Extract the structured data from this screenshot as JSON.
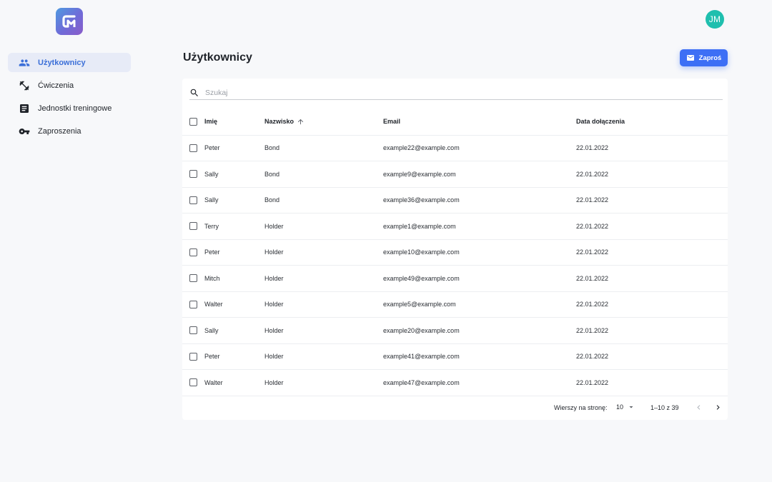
{
  "header": {
    "logo_icon": "app-logo-icon",
    "avatar_initials": "JM",
    "avatar_color": "#1fbfae"
  },
  "sidebar": {
    "items": [
      {
        "label": "Użytkownicy",
        "icon": "users-icon",
        "active": true
      },
      {
        "label": "Ćwiczenia",
        "icon": "fitness-icon",
        "active": false
      },
      {
        "label": "Jednostki treningowe",
        "icon": "list-icon",
        "active": false
      },
      {
        "label": "Zaproszenia",
        "icon": "key-icon",
        "active": false
      }
    ]
  },
  "main": {
    "title": "Użytkownicy",
    "invite_button": "Zaproś",
    "accent_color": "#3d6ff5",
    "search": {
      "placeholder": "Szukaj",
      "value": ""
    },
    "table": {
      "columns": [
        "Imię",
        "Nazwisko",
        "Email",
        "Data dołączenia"
      ],
      "sorted_column": "Nazwisko",
      "sort_direction": "ascending",
      "rows": [
        [
          "Peter",
          "Bond",
          "example22@example.com",
          "22.01.2022"
        ],
        [
          "Sally",
          "Bond",
          "example9@example.com",
          "22.01.2022"
        ],
        [
          "Sally",
          "Bond",
          "example36@example.com",
          "22.01.2022"
        ],
        [
          "Terry",
          "Holder",
          "example1@example.com",
          "22.01.2022"
        ],
        [
          "Peter",
          "Holder",
          "example10@example.com",
          "22.01.2022"
        ],
        [
          "Mitch",
          "Holder",
          "example49@example.com",
          "22.01.2022"
        ],
        [
          "Walter",
          "Holder",
          "example5@example.com",
          "22.01.2022"
        ],
        [
          "Sally",
          "Holder",
          "example20@example.com",
          "22.01.2022"
        ],
        [
          "Peter",
          "Holder",
          "example41@example.com",
          "22.01.2022"
        ],
        [
          "Walter",
          "Holder",
          "example47@example.com",
          "22.01.2022"
        ]
      ]
    },
    "pagination": {
      "rows_per_page_label": "Wierszy na stronę:",
      "rows_per_page": "10",
      "range": "1–10 z 39"
    }
  }
}
